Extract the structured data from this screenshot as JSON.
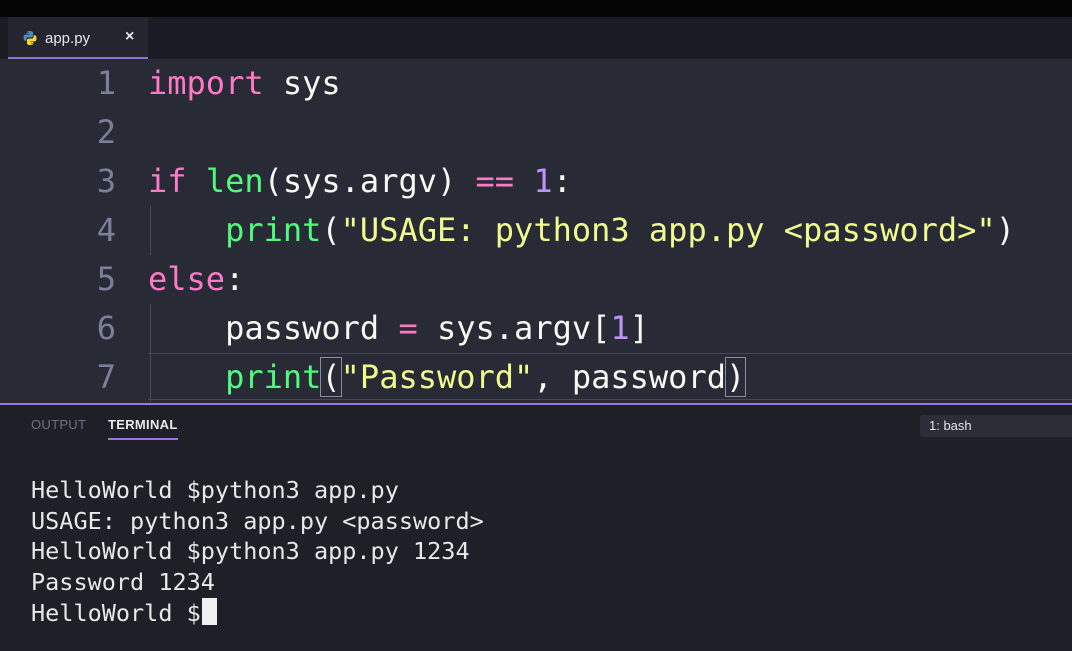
{
  "editor_tab": {
    "filename": "app.py",
    "close_glyph": "×",
    "icon": "python-icon"
  },
  "code_lines": [
    {
      "num": "1",
      "tokens": [
        {
          "t": "kw",
          "v": "import"
        },
        {
          "t": "p",
          "v": " sys"
        }
      ]
    },
    {
      "num": "2",
      "tokens": []
    },
    {
      "num": "3",
      "tokens": [
        {
          "t": "kw",
          "v": "if"
        },
        {
          "t": "p",
          "v": " "
        },
        {
          "t": "fn",
          "v": "len"
        },
        {
          "t": "p",
          "v": "(sys.argv) "
        },
        {
          "t": "kw",
          "v": "=="
        },
        {
          "t": "p",
          "v": " "
        },
        {
          "t": "num",
          "v": "1"
        },
        {
          "t": "p",
          "v": ":"
        }
      ]
    },
    {
      "num": "4",
      "tokens": [
        {
          "t": "p",
          "v": "    "
        },
        {
          "t": "fn",
          "v": "print"
        },
        {
          "t": "p",
          "v": "("
        },
        {
          "t": "str",
          "v": "\"USAGE: python3 app.py <password>\""
        },
        {
          "t": "p",
          "v": ")"
        }
      ]
    },
    {
      "num": "5",
      "tokens": [
        {
          "t": "kw",
          "v": "else"
        },
        {
          "t": "p",
          "v": ":"
        }
      ]
    },
    {
      "num": "6",
      "tokens": [
        {
          "t": "p",
          "v": "    password "
        },
        {
          "t": "kw",
          "v": "="
        },
        {
          "t": "p",
          "v": " sys.argv["
        },
        {
          "t": "num",
          "v": "1"
        },
        {
          "t": "p",
          "v": "]"
        }
      ]
    },
    {
      "num": "7",
      "tokens": [
        {
          "t": "p",
          "v": "    "
        },
        {
          "t": "fn",
          "v": "print"
        },
        {
          "t": "box",
          "v": "("
        },
        {
          "t": "str",
          "v": "\"Password\""
        },
        {
          "t": "p",
          "v": ", password"
        },
        {
          "t": "box",
          "v": ")"
        }
      ]
    }
  ],
  "panel": {
    "tabs": {
      "output": "OUTPUT",
      "terminal": "TERMINAL"
    },
    "active_tab": "TERMINAL",
    "shell_select": "1: bash"
  },
  "terminal_lines": [
    "HelloWorld $python3 app.py",
    "USAGE: python3 app.py <password>",
    "HelloWorld $python3 app.py 1234",
    "Password 1234",
    "HelloWorld $"
  ],
  "colors": {
    "keyword": "#ff79c6",
    "function": "#50fa7b",
    "string": "#f1fa8c",
    "number": "#bd93f9",
    "accent": "#9a77de"
  }
}
